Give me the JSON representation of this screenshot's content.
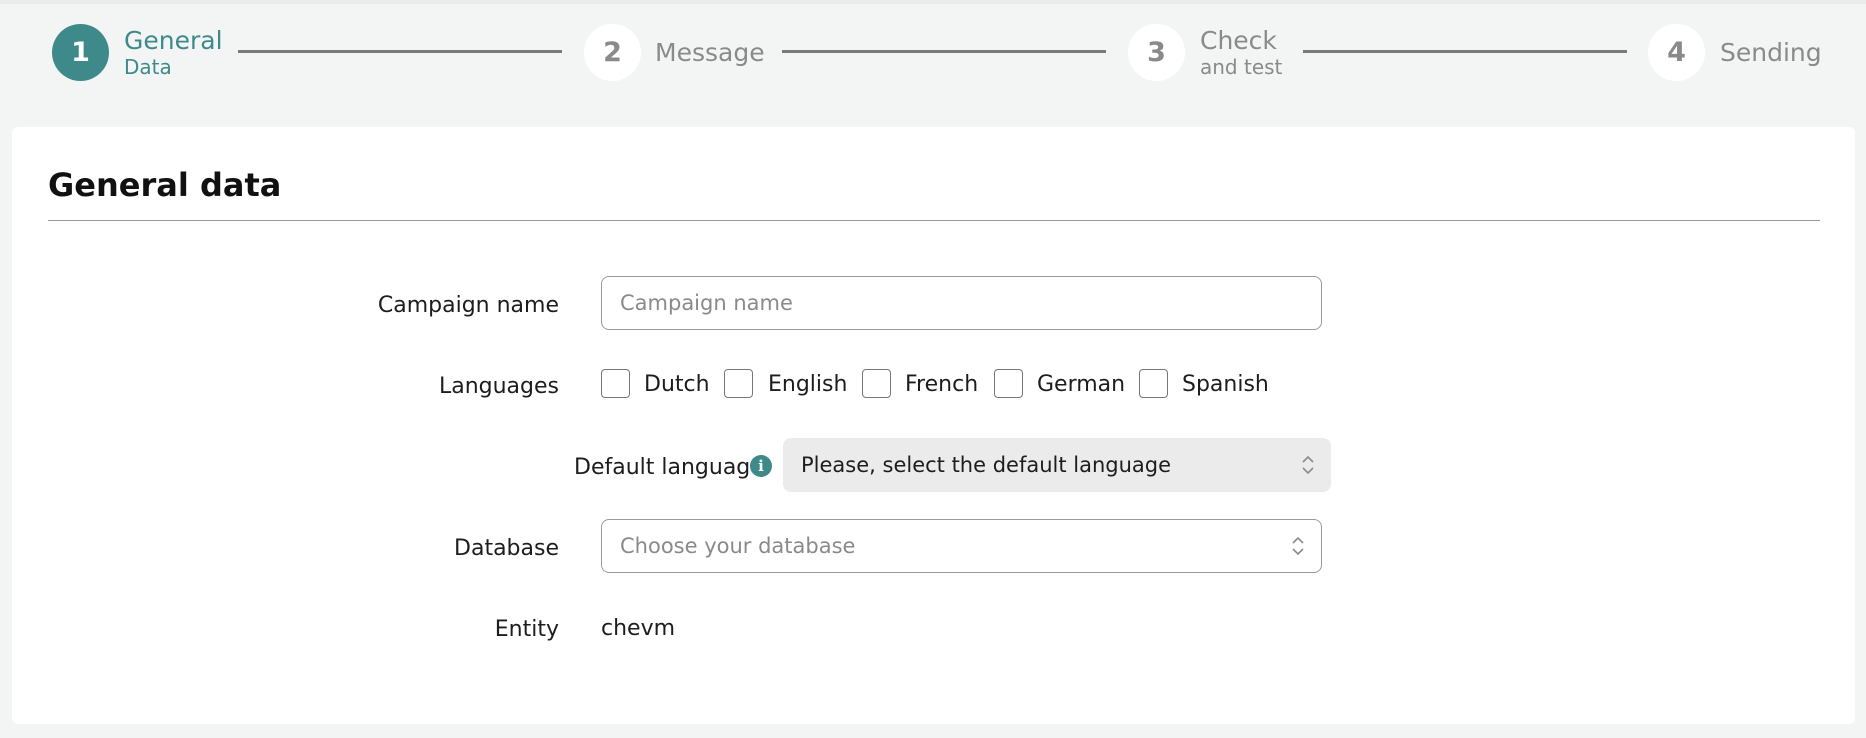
{
  "stepper": {
    "steps": [
      {
        "number": "1",
        "label": "General",
        "sublabel": "Data"
      },
      {
        "number": "2",
        "label": "Message"
      },
      {
        "number": "3",
        "label": "Check",
        "sublabel": "and test"
      },
      {
        "number": "4",
        "label": "Sending"
      }
    ],
    "active_step": 1
  },
  "card": {
    "title": "General data"
  },
  "form": {
    "campaign_name": {
      "label": "Campaign name",
      "value": "",
      "placeholder": "Campaign name"
    },
    "languages": {
      "label": "Languages",
      "options": [
        {
          "label": "Dutch",
          "checked": false
        },
        {
          "label": "English",
          "checked": false
        },
        {
          "label": "French",
          "checked": false
        },
        {
          "label": "German",
          "checked": false
        },
        {
          "label": "Spanish",
          "checked": false
        }
      ]
    },
    "default_language": {
      "label": "Default language",
      "info_icon": "info-icon",
      "value": "Please, select the default language"
    },
    "database": {
      "label": "Database",
      "value": "Choose your database"
    },
    "entity": {
      "label": "Entity",
      "value": "chevm"
    }
  },
  "colors": {
    "accent": "#3e8a8a",
    "background": "#f3f5f4",
    "muted_text": "#8a8a8a"
  }
}
